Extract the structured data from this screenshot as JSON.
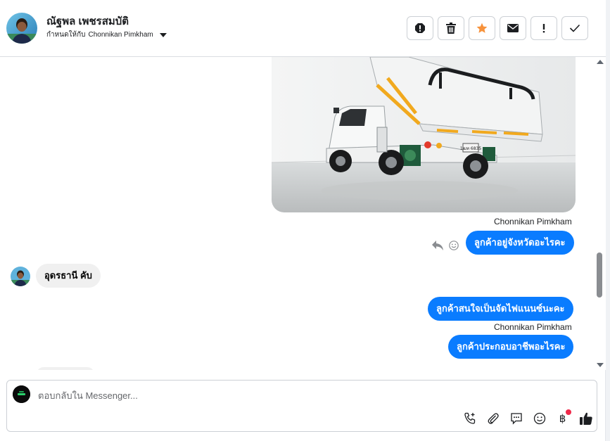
{
  "header": {
    "contact_name": "ณัฐพล เพชรสมบัติ",
    "assign_prefix": "กำหนดให้กับ",
    "assigned_to": "Chonnikan Pimkham",
    "toolbar": [
      {
        "name": "spam-button",
        "icon": "alert-circle-icon"
      },
      {
        "name": "delete-button",
        "icon": "trash-icon"
      },
      {
        "name": "star-button",
        "icon": "star-icon"
      },
      {
        "name": "mark-unread-button",
        "icon": "envelope-icon"
      },
      {
        "name": "follow-up-button",
        "icon": "exclamation-icon"
      },
      {
        "name": "mark-done-button",
        "icon": "check-icon"
      }
    ]
  },
  "messages": {
    "sender_1": "Chonnikan Pimkham",
    "out_1": "ลูกค้าอยู่จังหวัดอะไรคะ",
    "in_1": "อุดรธานี คับ",
    "out_2": "ลูกค้าสนใจเป็นจัดไฟแนนซ์นะคะ",
    "sender_2": "Chonnikan Pimkham",
    "out_3": "ลูกค้าประกอบอาชีพอะไรคะ",
    "truck_plate": "1ฒท 6835"
  },
  "composer": {
    "placeholder": "ตอบกลับใน Messenger..."
  },
  "colors": {
    "accent": "#0a7cff",
    "star": "#f7923b",
    "badge": "#f02849"
  }
}
